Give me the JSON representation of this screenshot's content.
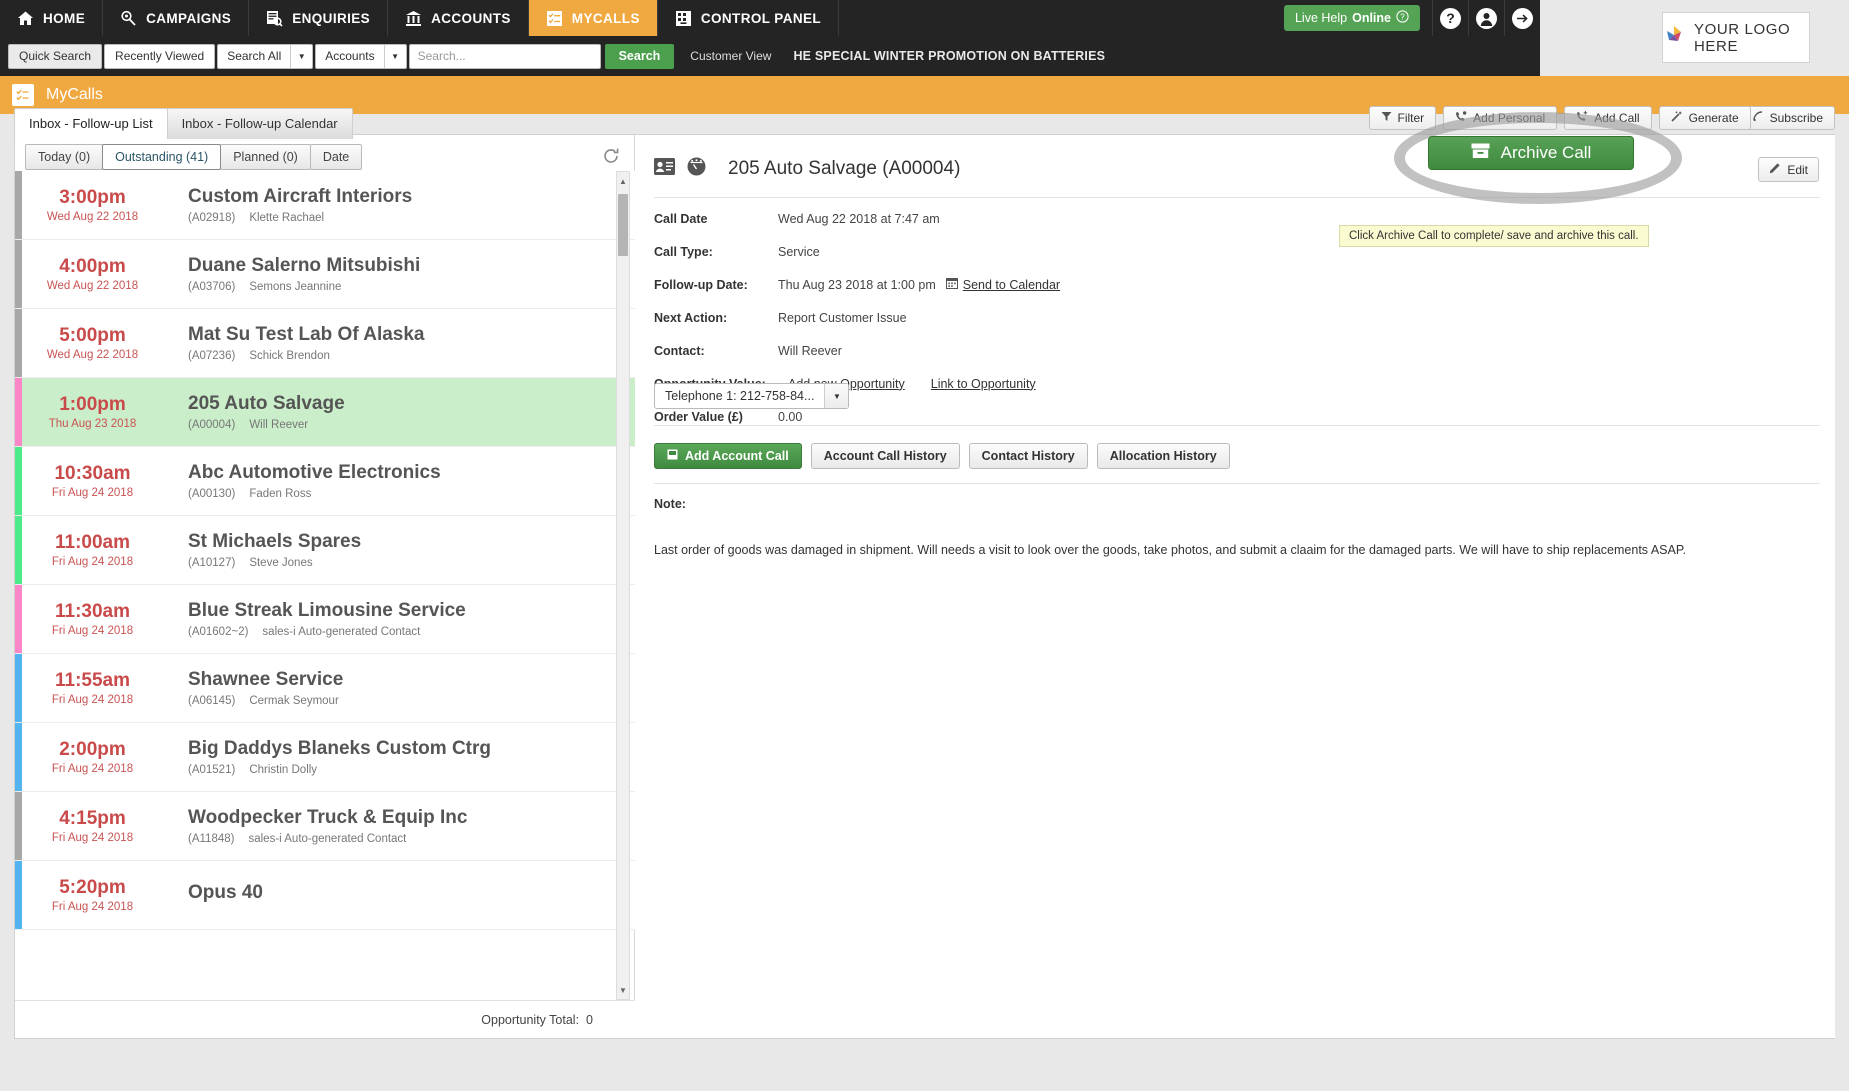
{
  "topnav": {
    "items": [
      {
        "label": "HOME",
        "icon": "home-icon",
        "active": false
      },
      {
        "label": "CAMPAIGNS",
        "icon": "megaphone-icon",
        "active": false
      },
      {
        "label": "ENQUIRIES",
        "icon": "enquiries-icon",
        "active": false
      },
      {
        "label": "ACCOUNTS",
        "icon": "bank-icon",
        "active": false
      },
      {
        "label": "MYCALLS",
        "icon": "checklist-icon",
        "active": true
      },
      {
        "label": "CONTROL PANEL",
        "icon": "control-panel-icon",
        "active": false
      }
    ],
    "live_help": "Live Help",
    "live_help_status": "Online",
    "help_icon": "question-mark-icon",
    "user_icon": "user-avatar-icon",
    "logout_icon": "arrow-right-icon"
  },
  "searchbar": {
    "quick_search": "Quick Search",
    "recently_viewed": "Recently Viewed",
    "scope": "Search All",
    "entity": "Accounts",
    "placeholder": "Search...",
    "search_button": "Search",
    "customer_view": "Customer View",
    "ticker": "HE SPECIAL WINTER PROMOTION ON BATTERIES"
  },
  "logo": {
    "text": "YOUR LOGO HERE"
  },
  "module": {
    "title": "MyCalls",
    "icon": "checklist-icon"
  },
  "tabs": [
    {
      "label": "Inbox - Follow-up List",
      "active": true
    },
    {
      "label": "Inbox - Follow-up Calendar",
      "active": false
    }
  ],
  "toolbar": [
    {
      "label": "Filter",
      "icon": "funnel-icon"
    },
    {
      "label": "Add Personal",
      "icon": "phone-add-icon"
    },
    {
      "label": "Add Call",
      "icon": "phone-plus-icon"
    },
    {
      "label": "Generate",
      "icon": "magic-wand-icon"
    },
    {
      "label": "Subscribe",
      "icon": "subscribe-icon"
    }
  ],
  "highlight": {
    "archive_button": "Archive Call",
    "archive_icon": "archive-box-icon",
    "tooltip": "Click Archive Call to complete/ save and archive this call."
  },
  "list": {
    "subtabs": [
      {
        "label": "Today (0)",
        "active": false
      },
      {
        "label": "Outstanding (41)",
        "active": true
      },
      {
        "label": "Planned (0)",
        "active": false
      },
      {
        "label": "Date",
        "active": false
      }
    ],
    "refresh_icon": "refresh-icon",
    "footer_label": "Opportunity Total:",
    "footer_value": "0",
    "rows": [
      {
        "time": "3:00pm",
        "date": "Wed Aug 22 2018",
        "name": "Custom Aircraft Interiors",
        "code": "(A02918)",
        "contact": "Klette Rachael",
        "bar": "#a8a8a8",
        "selected": false
      },
      {
        "time": "4:00pm",
        "date": "Wed Aug 22 2018",
        "name": "Duane Salerno Mitsubishi",
        "code": "(A03706)",
        "contact": "Semons Jeannine",
        "bar": "#a8a8a8",
        "selected": false
      },
      {
        "time": "5:00pm",
        "date": "Wed Aug 22 2018",
        "name": "Mat Su Test Lab Of Alaska",
        "code": "(A07236)",
        "contact": "Schick Brendon",
        "bar": "#a8a8a8",
        "selected": false
      },
      {
        "time": "1:00pm",
        "date": "Thu Aug 23 2018",
        "name": "205 Auto Salvage",
        "code": "(A00004)",
        "contact": "Will Reever",
        "bar": "#fc87c8",
        "selected": true
      },
      {
        "time": "10:30am",
        "date": "Fri Aug 24 2018",
        "name": "Abc Automotive Electronics",
        "code": "(A00130)",
        "contact": "Faden Ross",
        "bar": "#4cea8a",
        "selected": false
      },
      {
        "time": "11:00am",
        "date": "Fri Aug 24 2018",
        "name": "St Michaels Spares",
        "code": "(A10127)",
        "contact": "Steve Jones",
        "bar": "#4cea8a",
        "selected": false
      },
      {
        "time": "11:30am",
        "date": "Fri Aug 24 2018",
        "name": "Blue Streak Limousine Service",
        "code": "(A01602~2)",
        "contact": "sales-i Auto-generated Contact",
        "bar": "#fc87c8",
        "selected": false
      },
      {
        "time": "11:55am",
        "date": "Fri Aug 24 2018",
        "name": "Shawnee Service",
        "code": "(A06145)",
        "contact": "Cermak Seymour",
        "bar": "#54b4f0",
        "selected": false
      },
      {
        "time": "2:00pm",
        "date": "Fri Aug 24 2018",
        "name": "Big Daddys Blaneks Custom Ctrg",
        "code": "(A01521)",
        "contact": "Christin Dolly",
        "bar": "#54b4f0",
        "selected": false
      },
      {
        "time": "4:15pm",
        "date": "Fri Aug 24 2018",
        "name": "Woodpecker Truck & Equip Inc",
        "code": "(A11848)",
        "contact": "sales-i Auto-generated Contact",
        "bar": "#a8a8a8",
        "selected": false
      },
      {
        "time": "5:20pm",
        "date": "Fri Aug 24 2018",
        "name": "Opus 40",
        "code": "",
        "contact": "",
        "bar": "#54b4f0",
        "selected": false
      }
    ]
  },
  "detail": {
    "contact_card_icon": "contact-card-icon",
    "dashboard_icon": "speedometer-icon",
    "title": "205 Auto Salvage (A00004)",
    "edit_label": "Edit",
    "edit_icon": "pencil-icon",
    "fields": [
      {
        "key": "Call Date",
        "value": "Wed Aug 22 2018 at 7:47 am"
      },
      {
        "key": "Call Type:",
        "value": "Service"
      },
      {
        "key": "Follow-up Date:",
        "value": "Thu Aug 23 2018 at 1:00 pm",
        "link": "Send to Calendar",
        "link_icon": "calendar-icon"
      },
      {
        "key": "Next Action:",
        "value": "Report Customer Issue"
      },
      {
        "key": "Contact:",
        "value": "Will Reever"
      },
      {
        "key": "Opportunity Value:",
        "value": "",
        "link": "Add new Opportunity",
        "link2": "Link to Opportunity"
      },
      {
        "key": "Order Value (£)",
        "value": "0.00"
      }
    ],
    "telephone_select": "Telephone 1: 212-758-84...",
    "actions": [
      {
        "label": "Add Account Call",
        "style": "green",
        "icon": "add-call-icon"
      },
      {
        "label": "Account Call History",
        "style": "plain"
      },
      {
        "label": "Contact History",
        "style": "plain"
      },
      {
        "label": "Allocation History",
        "style": "plain"
      }
    ],
    "note_label": "Note:",
    "note_text": "Last order of goods was damaged in shipment. Will needs a visit to look over the goods, take photos, and submit a claaim for the damaged parts. We will have to ship replacements ASAP."
  }
}
